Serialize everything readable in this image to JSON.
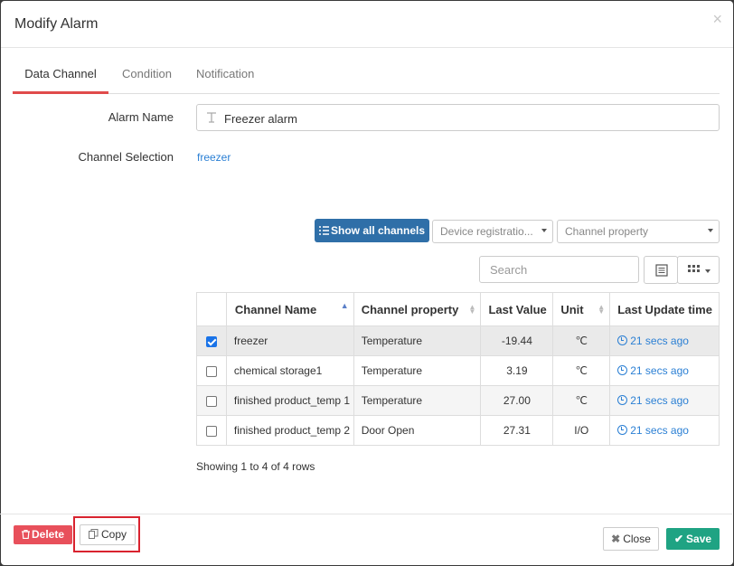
{
  "modal": {
    "title": "Modify Alarm",
    "close_glyph": "×"
  },
  "tabs": [
    {
      "label": "Data Channel"
    },
    {
      "label": "Condition"
    },
    {
      "label": "Notification"
    }
  ],
  "form": {
    "alarm_name_label": "Alarm Name",
    "alarm_name_value": "Freezer alarm",
    "channel_selection_label": "Channel Selection",
    "channel_selection_value": "freezer"
  },
  "toolbar": {
    "show_all_label": "Show all channels",
    "device_select": "Device registratio...",
    "property_select": "Channel property",
    "search_placeholder": "Search"
  },
  "table": {
    "columns": [
      "Channel Name",
      "Channel property",
      "Last Value",
      "Unit",
      "Last Update time"
    ],
    "rows": [
      {
        "checked": true,
        "name": "freezer",
        "property": "Temperature",
        "value": "-19.44",
        "unit": "℃",
        "updated": "21 secs ago"
      },
      {
        "checked": false,
        "name": "chemical storage1",
        "property": "Temperature",
        "value": "3.19",
        "unit": "℃",
        "updated": "21 secs ago"
      },
      {
        "checked": false,
        "name": "finished product_temp 1",
        "property": "Temperature",
        "value": "27.00",
        "unit": "℃",
        "updated": "21 secs ago"
      },
      {
        "checked": false,
        "name": "finished product_temp 2",
        "property": "Door Open",
        "value": "27.31",
        "unit": "I/O",
        "updated": "21 secs ago"
      }
    ],
    "pagination_text": "Showing 1 to 4 of 4 rows"
  },
  "footer": {
    "delete_label": "Delete",
    "copy_label": "Copy",
    "close_label": "Close",
    "save_label": "Save"
  },
  "colors": {
    "primary": "#2f6fa8",
    "danger": "#e8505b",
    "success": "#1fa383",
    "link": "#2a7fd4",
    "highlight": "#d9232f",
    "tab_active": "#e04b4b"
  }
}
